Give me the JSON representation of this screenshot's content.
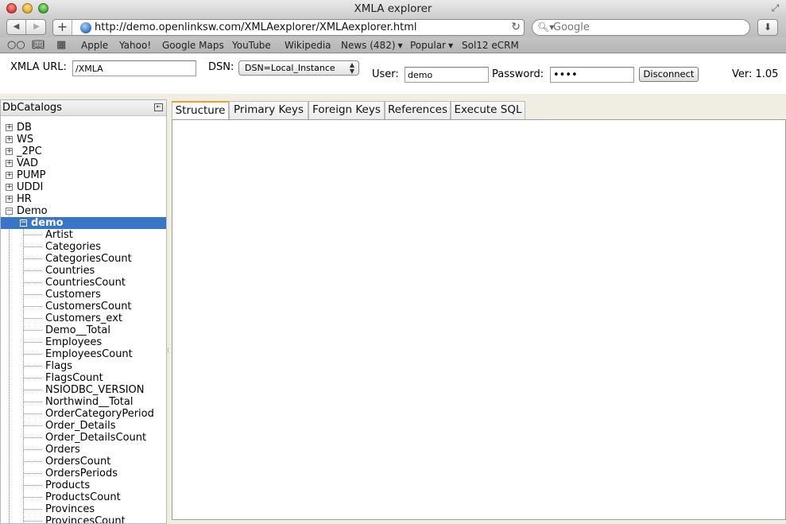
{
  "window": {
    "title": "XMLA explorer"
  },
  "browser": {
    "url": "http://demo.openlinksw.com/XMLAexplorer/XMLAexplorer.html",
    "search_placeholder": "Google",
    "bookmarks": [
      "Apple",
      "Yahoo!",
      "Google Maps",
      "YouTube",
      "Wikipedia"
    ],
    "bookmark_menus": [
      "News (482)",
      "Popular"
    ],
    "bookmark_last": "Sol12 eCRM"
  },
  "form": {
    "xmla_url_label": "XMLA URL:",
    "xmla_url_value": "/XMLA",
    "dsn_label": "DSN:",
    "dsn_value": "DSN=Local_Instance",
    "user_label": "User:",
    "user_value": "demo",
    "password_label": "Password:",
    "password_value": "demo",
    "disconnect_label": "Disconnect",
    "version": "Ver: 1.05"
  },
  "tree": {
    "header": "DbCatalogs",
    "catalogs": [
      "DB",
      "WS",
      "_2PC",
      "VAD",
      "PUMP",
      "UDDI",
      "HR"
    ],
    "expanded_catalog": "Demo",
    "selected_schema": "demo",
    "tables": [
      "Artist",
      "Categories",
      "CategoriesCount",
      "Countries",
      "CountriesCount",
      "Customers",
      "CustomersCount",
      "Customers_ext",
      "Demo__Total",
      "Employees",
      "EmployeesCount",
      "Flags",
      "FlagsCount",
      "NSIODBC_VERSION",
      "Northwind__Total",
      "OrderCategoryPeriod",
      "Order_Details",
      "Order_DetailsCount",
      "Orders",
      "OrdersCount",
      "OrdersPeriods",
      "Products",
      "ProductsCount",
      "Provinces",
      "ProvincesCount"
    ]
  },
  "tabs": [
    "Structure",
    "Primary Keys",
    "Foreign Keys",
    "References",
    "Execute SQL"
  ],
  "active_tab": "Structure",
  "colors": {
    "selection": "#3a76c8",
    "active_tab_accent": "#f29e28"
  }
}
